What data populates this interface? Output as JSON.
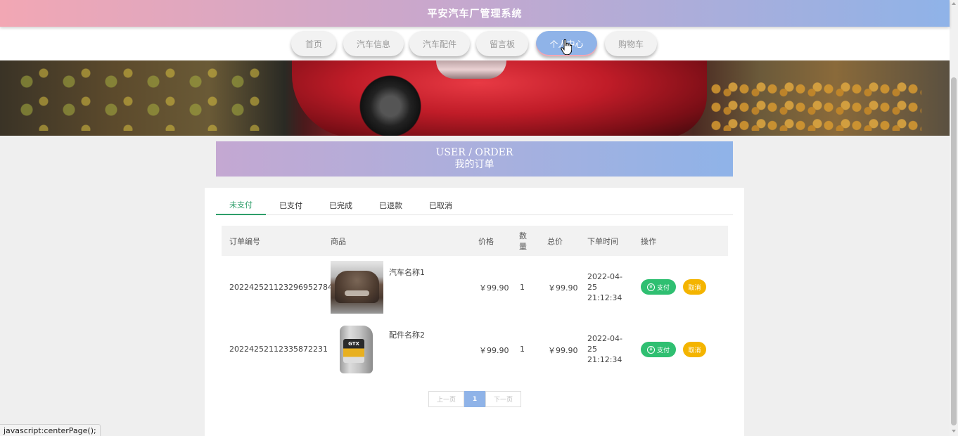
{
  "app": {
    "title": "平安汽车厂管理系统"
  },
  "nav": {
    "items": [
      {
        "label": "首页"
      },
      {
        "label": "汽车信息"
      },
      {
        "label": "汽车配件"
      },
      {
        "label": "留言板"
      },
      {
        "label": "个人中心",
        "active": true
      },
      {
        "label": "购物车"
      }
    ]
  },
  "section": {
    "title_en": "USER / ORDER",
    "title_cn": "我的订单"
  },
  "tabs": [
    {
      "label": "未支付",
      "active": true
    },
    {
      "label": "已支付"
    },
    {
      "label": "已完成"
    },
    {
      "label": "已退款"
    },
    {
      "label": "已取消"
    }
  ],
  "table": {
    "headers": {
      "order_no": "订单编号",
      "product": "商品",
      "price": "价格",
      "qty": "数量",
      "total": "总价",
      "time": "下单时间",
      "action": "操作"
    },
    "rows": [
      {
        "order_no": "20224252112329695278‌4",
        "product_name": "汽车名称1",
        "image": "car-photo",
        "price": "￥99.90",
        "qty": "1",
        "total": "￥99.90",
        "time": "2022-04-25 21:12:34",
        "pay_label": "支付",
        "cancel_label": "取消"
      },
      {
        "order_no": "20224252112335872231",
        "product_name": "配件名称2",
        "image": "engine-oil-bottle",
        "price": "￥99.90",
        "qty": "1",
        "total": "￥99.90",
        "time": "2022-04-25 21:12:34",
        "pay_label": "支付",
        "cancel_label": "取消"
      }
    ]
  },
  "pager": {
    "prev": "上一页",
    "current": "1",
    "next": "下一页"
  },
  "status_bar": {
    "text": "javascript:centerPage();"
  },
  "colors": {
    "accent_green": "#2e9e6a",
    "pay_green": "#2fbf71",
    "cancel_yellow": "#f4b400",
    "nav_active": "#8fb3e8",
    "header_pink": "#f2a7b4"
  }
}
